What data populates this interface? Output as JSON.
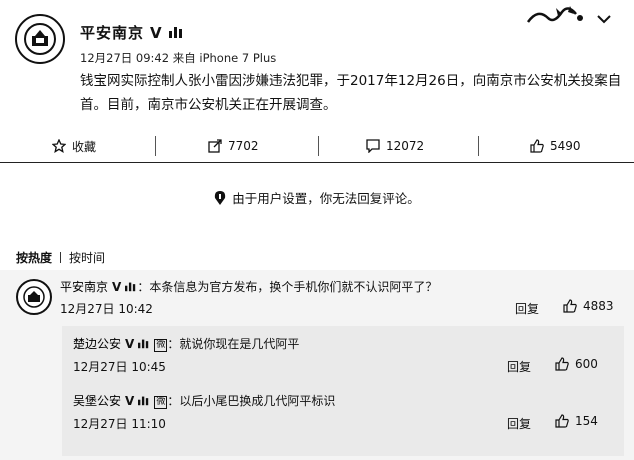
{
  "post": {
    "poster_name": "平安南京",
    "verified_mark": "V",
    "meta": "12月27日 09:42 来自 iPhone 7 Plus",
    "body": "钱宝网实际控制人张小雷因涉嫌违法犯罪，于2017年12月26日，向南京市公安机关投案自首。目前，南京市公安机关正在开展调查。"
  },
  "actions": {
    "favorite_label": "收藏",
    "repost_count": "7702",
    "comment_count": "12072",
    "like_count": "5490"
  },
  "notice": "由于用户设置，你无法回复评论。",
  "sort": {
    "hot": "按热度",
    "time": "按时间"
  },
  "comments": [
    {
      "user": "平安南京",
      "verified_mark": "V",
      "text": "：本条信息为官方发布，换个手机你们就不认识阿平了？",
      "time": "12月27日 10:42",
      "reply_label": "回复",
      "likes": "4883"
    }
  ],
  "replies": [
    {
      "user": "楚边公安",
      "verified_mark": "V",
      "badge": "微",
      "text": "：就说你现在是几代阿平",
      "time": "12月27日 10:45",
      "reply_label": "回复",
      "likes": "600"
    },
    {
      "user": "吴堡公安",
      "verified_mark": "V",
      "badge": "微",
      "text": "：以后小尾巴换成几代阿平标识",
      "time": "12月27日 11:10",
      "reply_label": "回复",
      "likes": "154"
    }
  ],
  "icons": [
    "police-emblem-icon",
    "member-icon",
    "chevron-down-icon",
    "star-icon",
    "repost-icon",
    "comment-icon",
    "thumbs-up-icon",
    "info-icon"
  ]
}
